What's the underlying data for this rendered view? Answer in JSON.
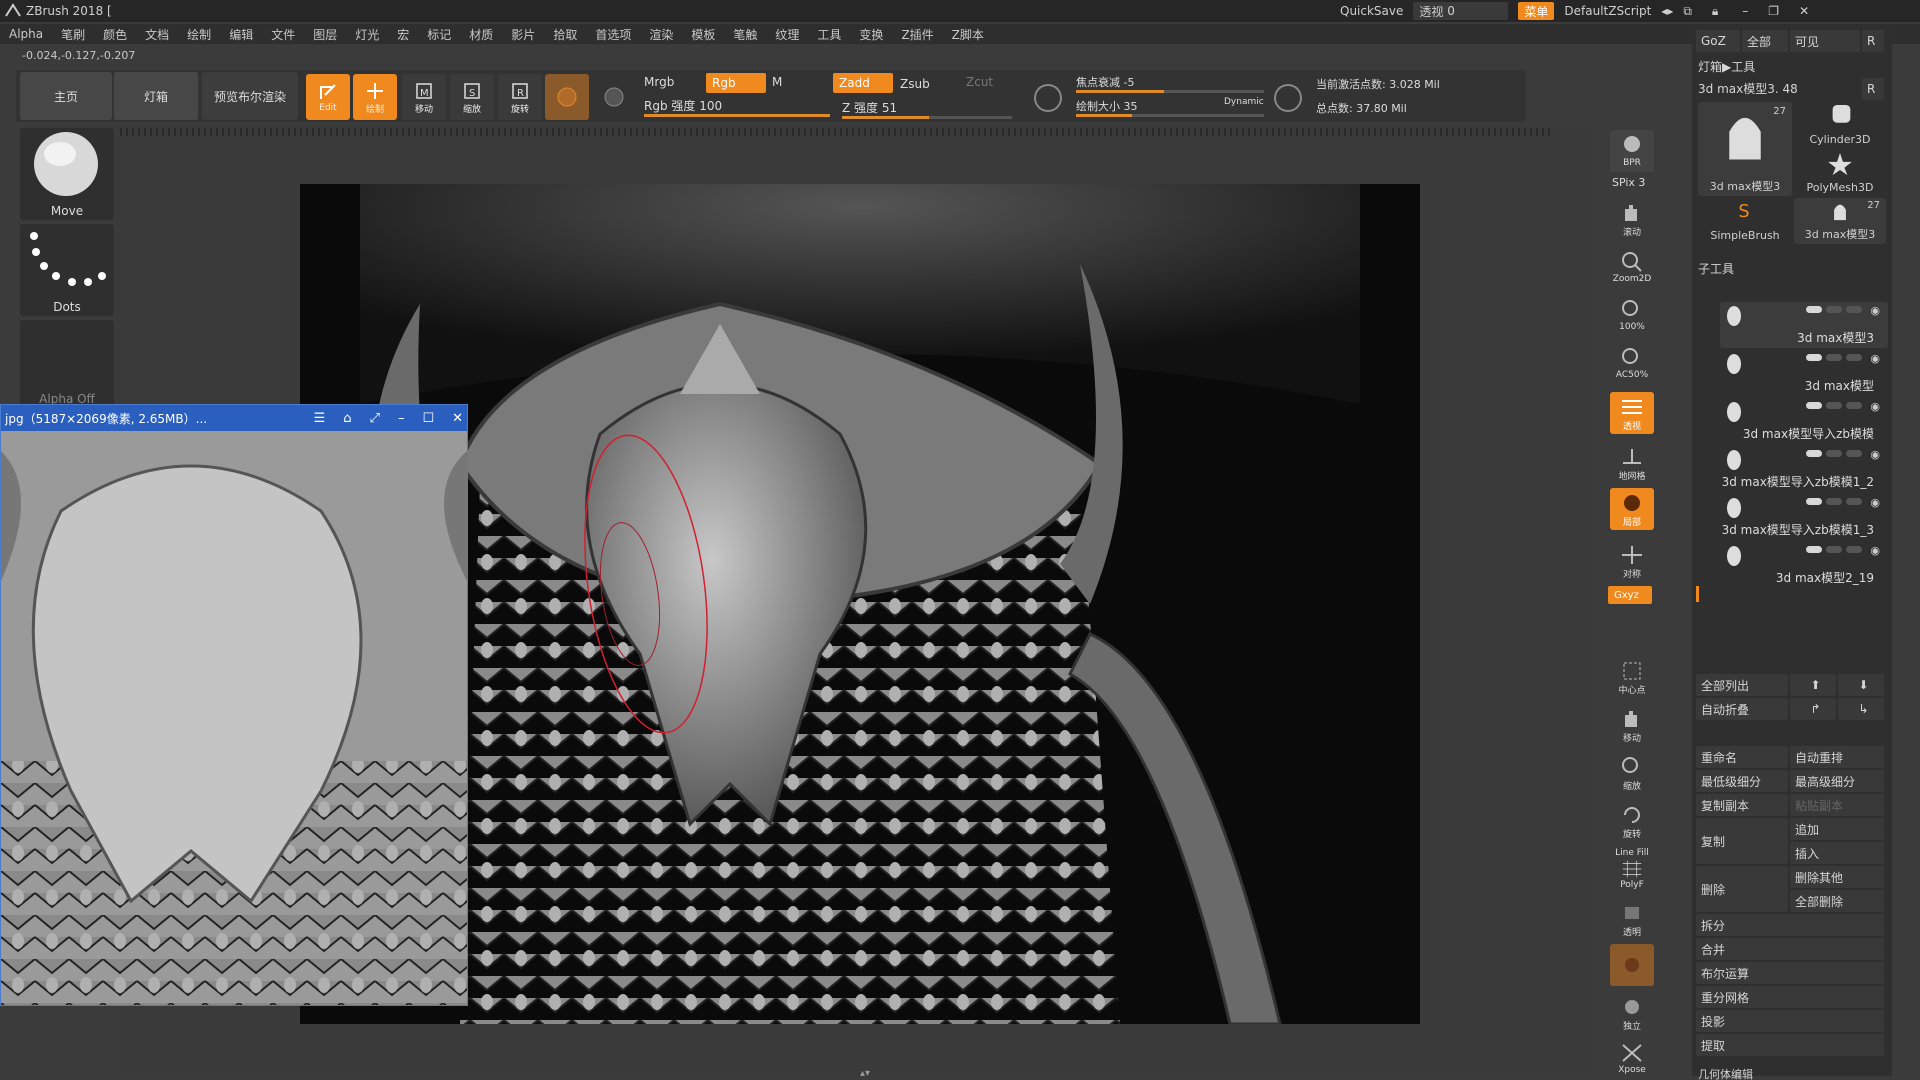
{
  "titlebar": {
    "app_title": "ZBrush 2018 [",
    "quicksave": "QuickSave",
    "transparency_label": "透视",
    "transparency_value": "0",
    "menu_label": "菜单",
    "script_label": "DefaultZScript"
  },
  "menubar": {
    "items": [
      "Alpha",
      "笔刷",
      "颜色",
      "文档",
      "绘制",
      "编辑",
      "文件",
      "图层",
      "灯光",
      "宏",
      "标记",
      "材质",
      "影片",
      "拾取",
      "首选项",
      "渲染",
      "模板",
      "笔触",
      "纹理",
      "工具",
      "变换",
      "Z插件",
      "Z脚本"
    ]
  },
  "coords": "-0.024,-0.127,-0.207",
  "shelf": {
    "home_tab": "主页",
    "lightbox_tab": "灯箱",
    "bpr_tab": "预览布尔渲染",
    "edit_label": "Edit",
    "draw_label": "绘制",
    "move_label": "移动",
    "scale_label": "缩放",
    "rotate_label": "旋转",
    "mrgb": "Mrgb",
    "rgb": "Rgb",
    "m": "M",
    "zadd": "Zadd",
    "zsub": "Zsub",
    "zcut": "Zcut",
    "rgb_intensity_label": "Rgb 强度",
    "rgb_intensity_value": "100",
    "z_intensity_label": "Z 强度",
    "z_intensity_value": "51",
    "focal_shift_label": "焦点衰减",
    "focal_shift_value": "-5",
    "draw_size_label": "绘制大小",
    "draw_size_value": "35",
    "dynamic": "Dynamic",
    "active_points": "当前激活点数: 3.028 Mil",
    "total_points": "总点数: 37.80 Mil",
    "rgb_intensity_fraction": 1.0,
    "z_intensity_fraction": 0.51,
    "focal_fraction": 0.47,
    "draw_size_fraction": 0.3
  },
  "left": {
    "brush_name": "Move",
    "stroke_name": "Dots",
    "alpha_name": "Alpha Off"
  },
  "refwindow": {
    "title": "jpg（5187×2069像素, 2.65MB）...",
    "menu_icon": "menu-icon",
    "pin_icon": "pin-icon",
    "fit_icon": "fit-icon"
  },
  "right_shelf": {
    "bpr": "BPR",
    "spix": "SPix 3",
    "scroll": "滚动",
    "zoom2d": "Zoom2D",
    "actual": "100%",
    "ac50": "AC50%",
    "perspective": "透视",
    "floor": "地网格",
    "local": "局部",
    "sym": "对称",
    "xyz": "Gxyz",
    "frame": "中心点",
    "move": "移动",
    "zoom": "缩放",
    "rotate": "旋转",
    "polyf": "PolyF",
    "linefill": "Line Fill",
    "transp": "透明",
    "ghost": "幽灵",
    "solo": "独立",
    "xpose": "Xpose"
  },
  "tool_panel": {
    "goz": "GoZ",
    "all": "全部",
    "visible": "可见",
    "r": "R",
    "lightbox_tools": "灯箱▶工具",
    "current_tool": "3d max模型3. 48",
    "tiles": [
      {
        "name": "3d max模型3",
        "count": "27"
      },
      {
        "name": "Cylinder3D",
        "count": ""
      },
      {
        "name": "PolyMesh3D",
        "count": ""
      },
      {
        "name": "SimpleBrush",
        "count": ""
      },
      {
        "name": "3d max模型3",
        "count": "27"
      }
    ],
    "subtool_header": "子工具",
    "subtools": [
      "3d max模型3",
      "3d max模型",
      "3d max模型导入zb模模",
      "3d max模型导入zb模模1_2",
      "3d max模型导入zb模模1_3",
      "3d max模型2_19"
    ],
    "list_all": "全部列出",
    "auto_collapse": "自动折叠",
    "rename": "重命名",
    "auto_reorder": "自动重排",
    "lowest_subdiv": "最低级细分",
    "highest_subdiv": "最高级细分",
    "duplicate": "复制副本",
    "paste_copy": "粘贴副本",
    "append": "追加",
    "copy": "复制",
    "insert": "插入",
    "delete": "删除",
    "delete_other": "删除其他",
    "delete_all": "全部删除",
    "split": "拆分",
    "merge": "合并",
    "boolean": "布尔运算",
    "remesh": "重分网格",
    "project": "投影",
    "extract": "提取",
    "geometry": "几何体编辑"
  }
}
